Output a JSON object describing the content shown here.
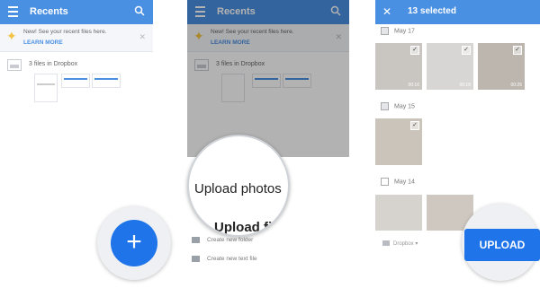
{
  "panel1": {
    "title": "Recents",
    "banner_message": "New! See your recent files here.",
    "banner_link": "LEARN MORE",
    "files_label": "3 files in Dropbox"
  },
  "panel2": {
    "title": "Recents",
    "banner_message": "New! See your recent files here.",
    "banner_link": "LEARN MORE",
    "files_label": "3 files in Dropbox",
    "magnified_upload_photos": "Upload photos",
    "magnified_upload_files": "Upload file",
    "menu_items": [
      "Create new folder",
      "Create new text file"
    ]
  },
  "panel3": {
    "title": "13 selected",
    "dates": [
      "May 17",
      "May 15",
      "May 14"
    ],
    "durations": [
      "00:16",
      "00:18",
      "00:26"
    ],
    "folder_label": "Dropbox",
    "upload_button": "UPLOAD"
  },
  "fab_label": "+",
  "icons": [
    "menu-icon",
    "search-icon",
    "sparkle-icon",
    "close-icon",
    "file-icon",
    "folder-icon",
    "check-icon",
    "plus-icon"
  ],
  "colors": {
    "appbar": "#4a90e2",
    "fab": "#1e74e8",
    "accent": "#4a90e2"
  }
}
